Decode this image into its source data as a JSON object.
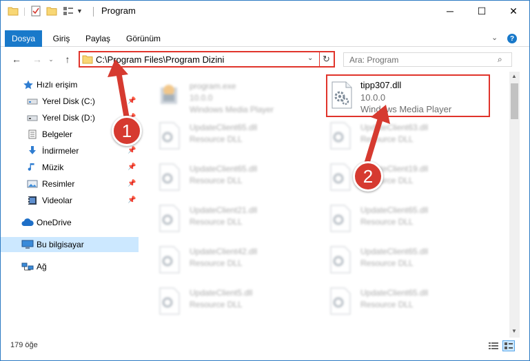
{
  "window": {
    "title": "Program",
    "controls": {
      "minimize": "─",
      "maximize": "☐",
      "close": "✕"
    }
  },
  "ribbon": {
    "tabs": [
      "Dosya",
      "Giriş",
      "Paylaş",
      "Görünüm"
    ],
    "help": "?"
  },
  "nav": {
    "address": "C:\\Program Files\\Program Dizini",
    "search_placeholder": "Ara: Program"
  },
  "sidebar": {
    "items": [
      {
        "label": "Hızlı erişim",
        "icon": "star-icon"
      },
      {
        "label": "Yerel Disk (C:)",
        "icon": "drive-icon",
        "pinned": true
      },
      {
        "label": "Yerel Disk (D:)",
        "icon": "drive-icon",
        "pinned": true
      },
      {
        "label": "Belgeler",
        "icon": "documents-icon",
        "pinned": true
      },
      {
        "label": "İndirmeler",
        "icon": "download-icon",
        "pinned": true
      },
      {
        "label": "Müzik",
        "icon": "music-icon",
        "pinned": true
      },
      {
        "label": "Resimler",
        "icon": "pictures-icon",
        "pinned": true
      },
      {
        "label": "Videolar",
        "icon": "videos-icon",
        "pinned": true
      },
      {
        "label": "OneDrive",
        "icon": "cloud-icon"
      },
      {
        "label": "Bu bilgisayar",
        "icon": "computer-icon",
        "selected": true
      },
      {
        "label": "Ağ",
        "icon": "network-icon"
      }
    ]
  },
  "files": [
    {
      "name": "program.exe",
      "line2": "10.0.0",
      "line3": "Windows Media Player",
      "icon": "exe-icon"
    },
    {
      "name": "tipp307.dll",
      "line2": "10.0.0",
      "line3": "Windows Media Player",
      "icon": "dll-gear-icon",
      "highlighted": true
    },
    {
      "name": "UpdateClient65.dll",
      "line2": "Resource DLL",
      "icon": "dll-gear-icon"
    },
    {
      "name": "UpdateClient63.dll",
      "line2": "Resource DLL",
      "icon": "dll-gear-icon"
    },
    {
      "name": "UpdateClient65.dll",
      "line2": "Resource DLL",
      "icon": "dll-gear-icon"
    },
    {
      "name": "UpdateClient19.dll",
      "line2": "Resource DLL",
      "icon": "dll-gear-icon"
    },
    {
      "name": "UpdateClient21.dll",
      "line2": "Resource DLL",
      "icon": "dll-gear-icon"
    },
    {
      "name": "UpdateClient65.dll",
      "line2": "Resource DLL",
      "icon": "dll-gear-icon"
    },
    {
      "name": "UpdateClient42.dll",
      "line2": "Resource DLL",
      "icon": "dll-gear-icon"
    },
    {
      "name": "UpdateClient65.dll",
      "line2": "Resource DLL",
      "icon": "dll-gear-icon"
    },
    {
      "name": "UpdateClient5.dll",
      "line2": "Resource DLL",
      "icon": "dll-gear-icon"
    },
    {
      "name": "UpdateClient65.dll",
      "line2": "Resource DLL",
      "icon": "dll-gear-icon"
    }
  ],
  "status": {
    "count": "179 öğe"
  },
  "annotations": {
    "step1": "1",
    "step2": "2",
    "color": "#d63a30"
  }
}
